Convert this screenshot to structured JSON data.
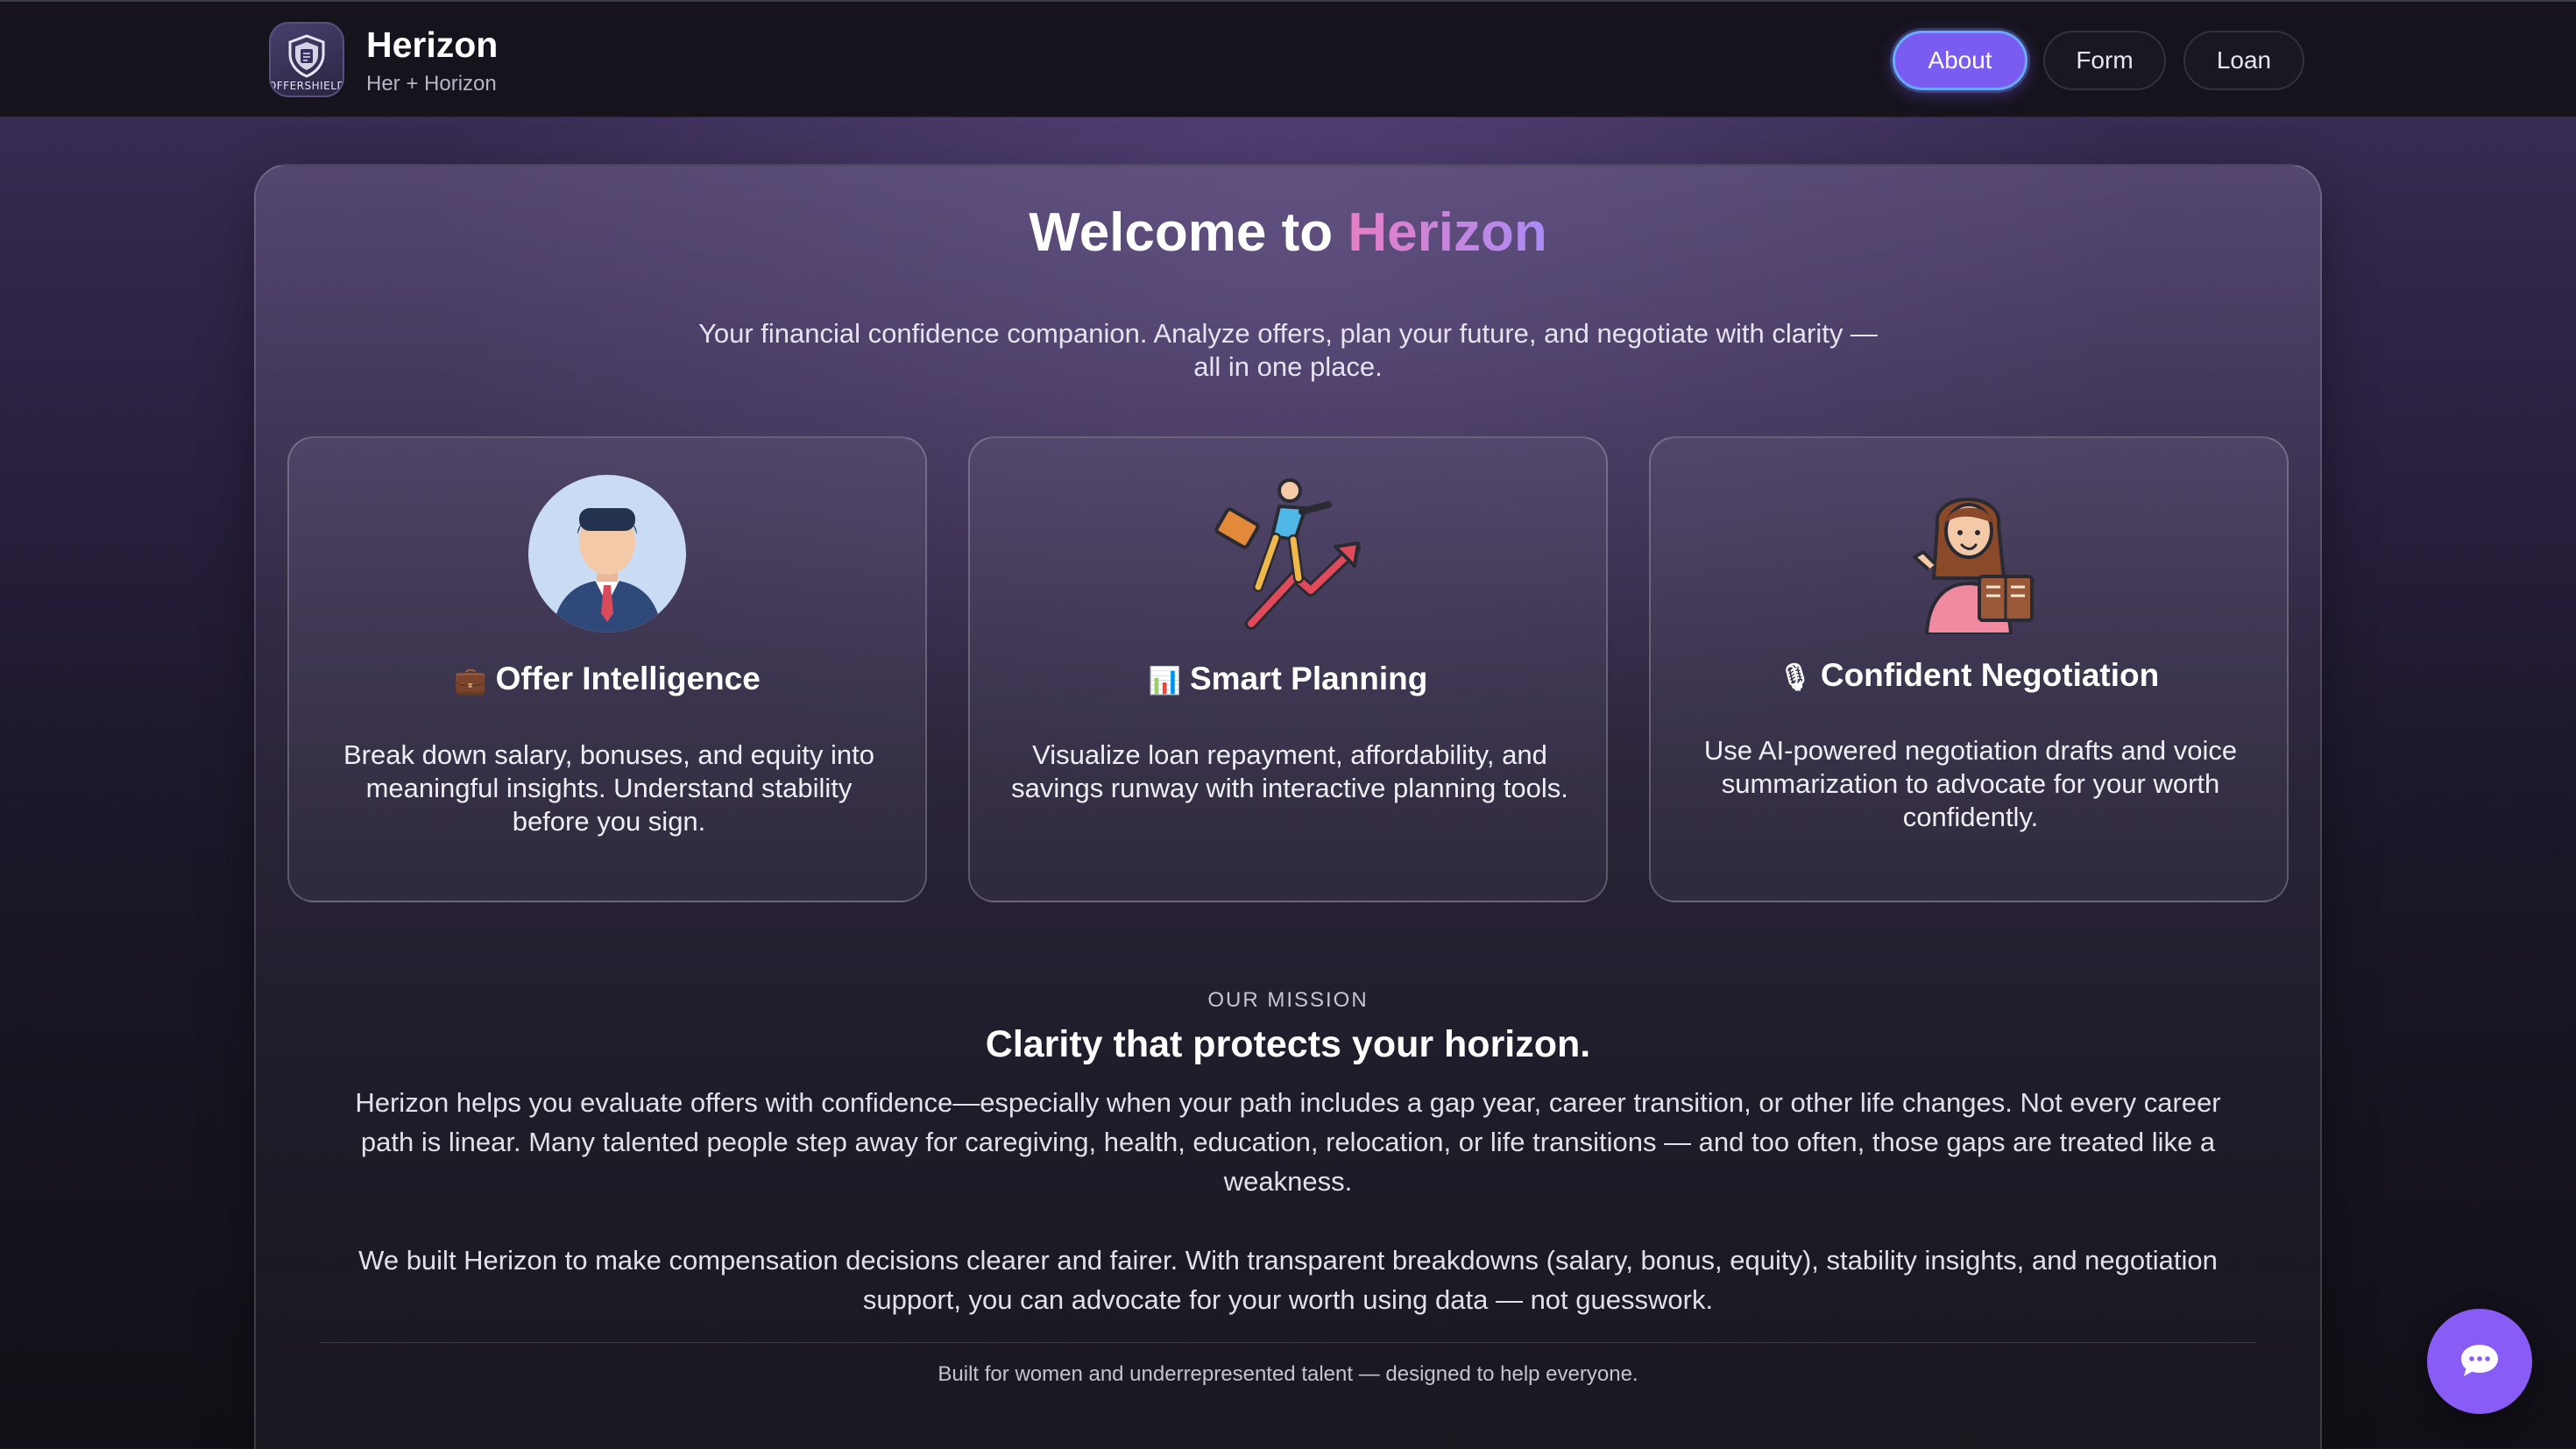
{
  "brand": {
    "title": "Herizon",
    "subtitle": "Her + Horizon",
    "logo_text": "OFFERSHIELD"
  },
  "nav": {
    "items": [
      {
        "label": "About",
        "active": true
      },
      {
        "label": "Form",
        "active": false
      },
      {
        "label": "Loan",
        "active": false
      }
    ]
  },
  "hero": {
    "welcome_prefix": "Welcome to ",
    "welcome_brand": "Herizon",
    "intro": "Your financial confidence companion. Analyze offers, plan your future, and negotiate with clarity — all in one place."
  },
  "features": [
    {
      "icon": "briefcase-emoji",
      "emoji": "💼",
      "illustration": "businessman-avatar",
      "title": "Offer Intelligence",
      "description": "Break down salary, bonuses, and equity into meaningful insights. Understand stability before you sign."
    },
    {
      "icon": "bar-chart-emoji",
      "emoji": "📊",
      "illustration": "climbing-growth-arrow",
      "title": "Smart Planning",
      "description": "Visualize loan repayment, affordability, and savings runway with interactive planning tools."
    },
    {
      "icon": "microphone-emoji",
      "emoji": "🎙",
      "illustration": "woman-with-book",
      "title": "Confident Negotiation",
      "description": "Use AI-powered negotiation drafts and voice summarization to advocate for your worth confidently."
    }
  ],
  "mission": {
    "label": "OUR MISSION",
    "title": "Clarity that protects your horizon.",
    "paragraph1": "Herizon helps you evaluate offers with confidence—especially when your path includes a gap year, career transition, or other life changes. Not every career path is linear. Many talented people step away for caregiving, health, education, relocation, or life transitions — and too often, those gaps are treated like a weakness.",
    "paragraph2": "We built Herizon to make compensation decisions clearer and fairer. With transparent breakdowns (salary, bonus, equity), stability insights, and negotiation support, you can advocate for your worth using data — not guesswork.",
    "footnote": "Built for women and underrepresented talent — designed to help everyone."
  },
  "chat": {
    "icon": "chat-bubble-icon"
  },
  "colors": {
    "accent": "#7b5cf0",
    "accent_ring": "#6ba8ff",
    "brand_gradient_start": "#e77fc4",
    "brand_gradient_end": "#a98bf5",
    "chat_fab": "#8a5cf6"
  }
}
